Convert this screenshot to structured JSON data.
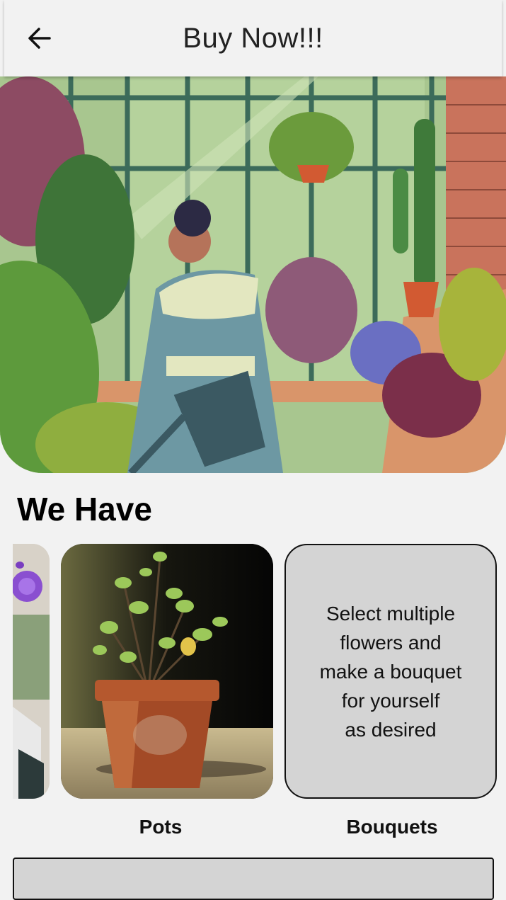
{
  "header": {
    "title": "Buy Now!!!",
    "back_icon": "arrow-left-icon"
  },
  "hero": {
    "image": "greenhouse-woman-watering-plants-illustration"
  },
  "section": {
    "heading": "We Have"
  },
  "categories": [
    {
      "label": "",
      "image": "purple-rose-photo"
    },
    {
      "label": "Pots",
      "image": "potted-plant-photo"
    },
    {
      "label": "Bouquets",
      "description": "Select multiple\nflowers and\nmake a bouquet\nfor yourself\nas desired"
    }
  ],
  "colors": {
    "background": "#f2f2f2",
    "card_gray": "#d4d4d4",
    "text": "#111111"
  }
}
